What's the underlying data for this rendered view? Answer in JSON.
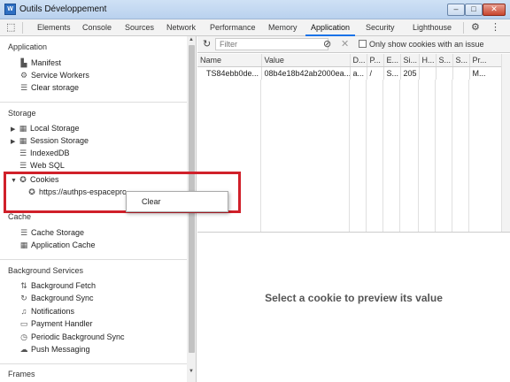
{
  "window": {
    "title": "Outils Développement",
    "icon_text": "W"
  },
  "tabs": [
    {
      "label": "Elements"
    },
    {
      "label": "Console"
    },
    {
      "label": "Sources"
    },
    {
      "label": "Network"
    },
    {
      "label": "Performance"
    },
    {
      "label": "Memory"
    },
    {
      "label": "Application"
    },
    {
      "label": "Security"
    },
    {
      "label": "Lighthouse"
    }
  ],
  "active_tab": "Application",
  "sidebar": {
    "application": {
      "heading": "Application",
      "items": [
        {
          "label": "Manifest"
        },
        {
          "label": "Service Workers"
        },
        {
          "label": "Clear storage"
        }
      ]
    },
    "storage": {
      "heading": "Storage",
      "items": [
        {
          "label": "Local Storage"
        },
        {
          "label": "Session Storage"
        },
        {
          "label": "IndexedDB"
        },
        {
          "label": "Web SQL"
        },
        {
          "label": "Cookies"
        }
      ],
      "cookie_origin": "https://authps-espacepro...."
    },
    "cache": {
      "heading": "Cache",
      "items": [
        {
          "label": "Cache Storage"
        },
        {
          "label": "Application Cache"
        }
      ]
    },
    "background": {
      "heading": "Background Services",
      "items": [
        {
          "label": "Background Fetch"
        },
        {
          "label": "Background Sync"
        },
        {
          "label": "Notifications"
        },
        {
          "label": "Payment Handler"
        },
        {
          "label": "Periodic Background Sync"
        },
        {
          "label": "Push Messaging"
        }
      ]
    },
    "frames": {
      "heading": "Frames"
    }
  },
  "context_menu": {
    "items": [
      {
        "label": "Clear"
      }
    ]
  },
  "toolbar": {
    "filter_placeholder": "Filter",
    "only_issues_label": "Only show cookies with an issue"
  },
  "table": {
    "columns": [
      "Name",
      "Value",
      "D...",
      "P...",
      "E...",
      "Si...",
      "H...",
      "S...",
      "S...",
      "Pr..."
    ],
    "rows": [
      [
        "TS84ebb0de...",
        "08b4e18b42ab2000ea...",
        "a...",
        "/",
        "S...",
        "205",
        "",
        "",
        "",
        "M..."
      ]
    ]
  },
  "preview": {
    "message": "Select a cookie to preview its value"
  }
}
